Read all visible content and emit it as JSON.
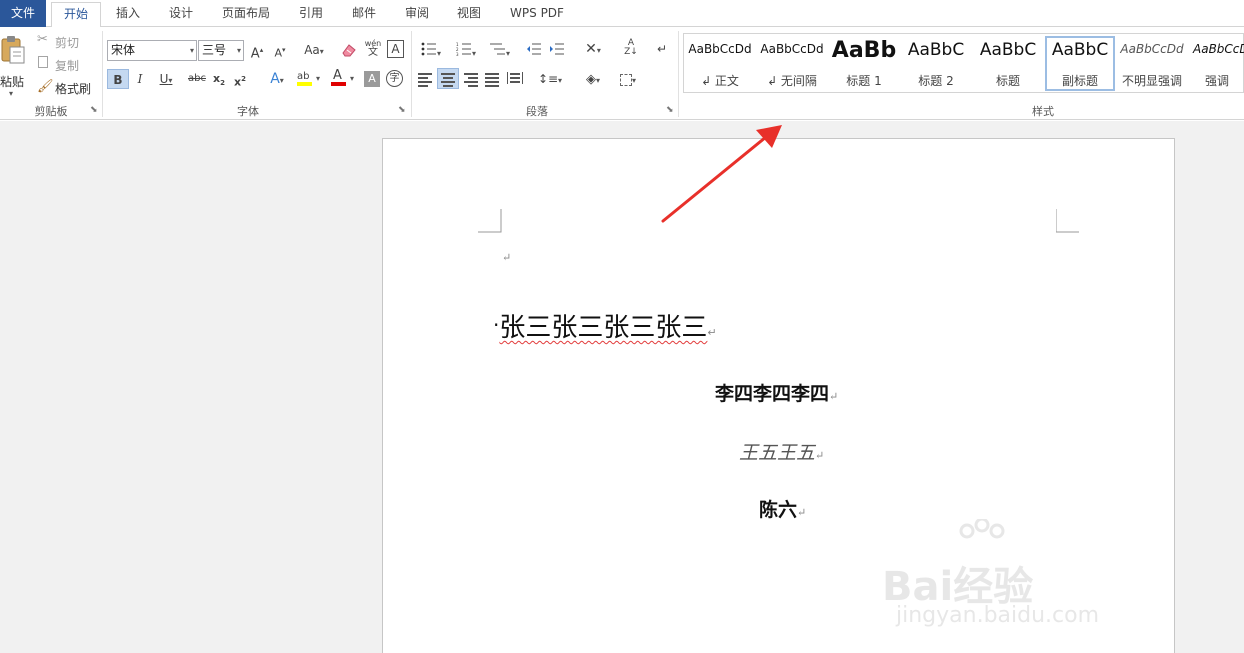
{
  "tabs": [
    "文件",
    "开始",
    "插入",
    "设计",
    "页面布局",
    "引用",
    "邮件",
    "审阅",
    "视图",
    "WPS PDF"
  ],
  "clipboard": {
    "paste": "粘贴",
    "cut": "剪切",
    "copy": "复制",
    "format_painter": "格式刷",
    "group_label": "剪贴板"
  },
  "font": {
    "font_name": "宋体",
    "font_size": "三号",
    "clear_format_label": "Aa",
    "pinyin_label": "wén",
    "group_label": "字体",
    "highlight_color": "#ffff00",
    "font_color": "#e00000"
  },
  "paragraph": {
    "group_label": "段落"
  },
  "styles": {
    "group_label": "样式",
    "items": [
      {
        "preview": "AaBbCcDd",
        "name": "↲ 正文"
      },
      {
        "preview": "AaBbCcDd",
        "name": "↲ 无间隔"
      },
      {
        "preview": "AaBb",
        "name": "标题 1"
      },
      {
        "preview": "AaBbC",
        "name": "标题 2"
      },
      {
        "preview": "AaBbC",
        "name": "标题"
      },
      {
        "preview": "AaBbC",
        "name": "副标题"
      },
      {
        "preview": "AaBbCcDd",
        "name": "不明显强调"
      },
      {
        "preview": "AaBbCcDd",
        "name": "强调"
      }
    ]
  },
  "document": {
    "empty_mark": "↵",
    "line1": "张三张三张三张三",
    "line2": "李四李四李四",
    "line3": "王五王五",
    "line4": "陈六",
    "para_mark": "↵"
  },
  "annotation": {
    "arrow_color": "#e8302a"
  },
  "watermark": {
    "brand": "Bai经验",
    "url": "jingyan.baidu.com"
  }
}
